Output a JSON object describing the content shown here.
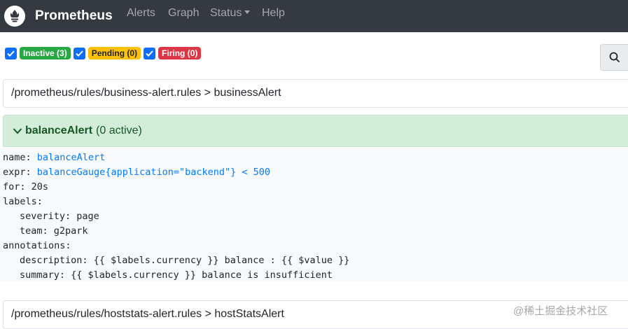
{
  "navbar": {
    "brand": "Prometheus",
    "links": {
      "alerts": "Alerts",
      "graph": "Graph",
      "status": "Status",
      "help": "Help"
    }
  },
  "filters": {
    "inactive": "Inactive (3)",
    "pending": "Pending (0)",
    "firing": "Firing (0)",
    "colors": {
      "inactive": "#28a745",
      "pending": "#ffc107",
      "firing": "#dc3545"
    }
  },
  "groups": [
    {
      "header": "/prometheus/rules/business-alert.rules > businessAlert"
    },
    {
      "header": "/prometheus/rules/hoststats-alert.rules > hostStatsAlert"
    }
  ],
  "alert": {
    "name": "balanceAlert",
    "active": "(0 active)",
    "rule": {
      "name_key": "name:",
      "name_val": "balanceAlert",
      "expr_key": "expr:",
      "expr_val": "balanceGauge{application=\"backend\"} < 500",
      "for_line": "for: 20s",
      "labels_key": "labels:",
      "severity_line": "severity: page",
      "team_line": "team: g2park",
      "annotations_key": "annotations:",
      "description_line": "description: {{ $labels.currency }} balance : {{ $value }}",
      "summary_line": "summary: {{ $labels.currency }} balance is insufficient"
    }
  },
  "watermark": "@稀土掘金技术社区"
}
